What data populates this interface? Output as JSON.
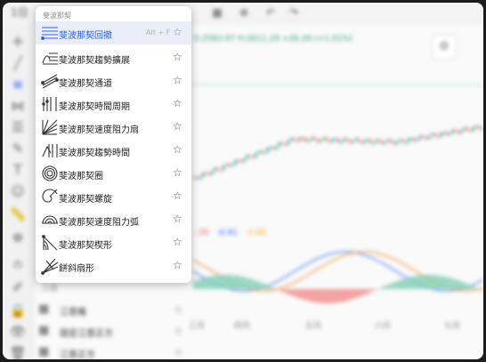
{
  "toolbar": {
    "symbol_label": "1日",
    "buttons": [
      "bars-icon",
      "undo-icon",
      "redo-icon"
    ]
  },
  "chart": {
    "price_legend": "O:2583.97  H:2611.29 +26.29 (+1.01%)",
    "indicator_values": [
      "-.35",
      "-0.91",
      "-1.05"
    ],
    "x_axis_labels": [
      "三月",
      "四月",
      "五月",
      "六月",
      "七月"
    ]
  },
  "menu": {
    "header": "斐波那契",
    "items": [
      {
        "label": "斐波那契回撤",
        "icon": "fib-retracement-icon",
        "shortcut": "Alt + F",
        "active": true
      },
      {
        "label": "斐波那契趨勢擴展",
        "icon": "fib-trend-extension-icon",
        "shortcut": "",
        "active": false
      },
      {
        "label": "斐波那契通道",
        "icon": "fib-channel-icon",
        "shortcut": "",
        "active": false
      },
      {
        "label": "斐波那契時間周期",
        "icon": "fib-time-zone-icon",
        "shortcut": "",
        "active": false
      },
      {
        "label": "斐波那契速度阻力扇",
        "icon": "fib-speed-fan-icon",
        "shortcut": "",
        "active": false
      },
      {
        "label": "斐波那契趨勢時間",
        "icon": "fib-trend-time-icon",
        "shortcut": "",
        "active": false
      },
      {
        "label": "斐波那契圈",
        "icon": "fib-circles-icon",
        "shortcut": "",
        "active": false
      },
      {
        "label": "斐波那契螺旋",
        "icon": "fib-spiral-icon",
        "shortcut": "",
        "active": false
      },
      {
        "label": "斐波那契速度阻力弧",
        "icon": "fib-speed-arcs-icon",
        "shortcut": "",
        "active": false
      },
      {
        "label": "斐波那契楔形",
        "icon": "fib-wedge-icon",
        "shortcut": "",
        "active": false
      },
      {
        "label": "餅斜扇形",
        "icon": "pitchfan-icon",
        "shortcut": "",
        "active": false
      }
    ]
  },
  "below_menu": {
    "header": "江恩",
    "items": [
      {
        "label": "江恩箱"
      },
      {
        "label": "固定江恩正方"
      },
      {
        "label": "江恩正方"
      }
    ]
  },
  "colors": {
    "accent": "#2962ff",
    "up": "#26a69a",
    "down": "#ef5350",
    "active_row": "#e9eef8"
  }
}
